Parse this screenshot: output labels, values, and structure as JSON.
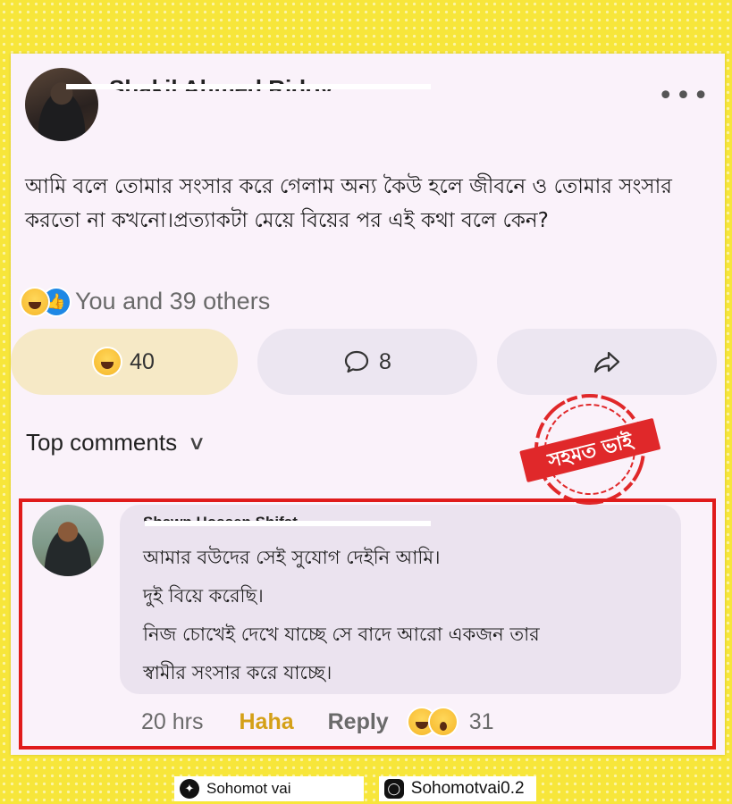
{
  "post": {
    "author_name": "Shakil Ahmed Ridoy",
    "more_icon": "more-icon",
    "text": "আমি বলে তোমার সংসার করে গেলাম অন্য কৈউ হলে জীবনে ও তোমার সংসার করতো না কখনো।প্রত্যাকটা মেয়ে বিয়ের পর এই কথা বলে কেন?",
    "reaction_summary": "You and 39 others",
    "actions": {
      "react_count": "40",
      "comment_count": "8",
      "share_icon": "share-icon"
    }
  },
  "top_comments": {
    "label": "Top comments"
  },
  "stamp": {
    "text": "সহমত ভাই",
    "color": "#e0282a"
  },
  "comment": {
    "author_name": "Shawn Hossen Shifat",
    "lines": [
      "আমার বউদের সেই সুযোগ দেইনি আমি।",
      "দুই বিয়ে করেছি।",
      "নিজ চোখেই দেখে যাচ্ছে সে বাদে আরো একজন তার",
      "স্বামীর সংসার করে যাচ্ছে।"
    ],
    "time": "20 hrs",
    "haha_label": "Haha",
    "reply_label": "Reply",
    "reaction_count": "31"
  },
  "footer": {
    "twitter_handle": "Sohomot vai",
    "instagram_handle": "Sohomotvai0.2"
  },
  "colors": {
    "background": "#f7e63a",
    "highlight_border": "#e01b1b",
    "haha_text": "#d4a017"
  }
}
